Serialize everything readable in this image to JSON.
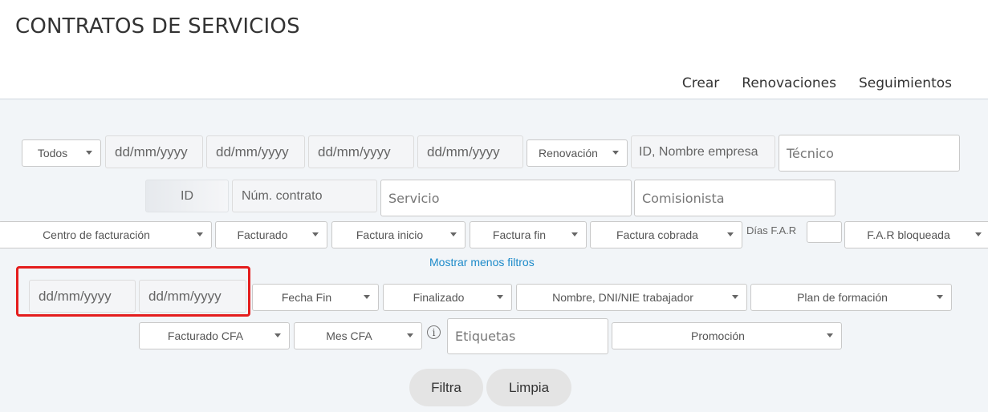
{
  "page": {
    "title": "CONTRATOS DE SERVICIOS"
  },
  "nav": {
    "crear": "Crear",
    "renovaciones": "Renovaciones",
    "seguimientos": "Seguimientos"
  },
  "filters": {
    "row1": {
      "todos": "Todos",
      "date1": "dd/mm/yyyy",
      "date2": "dd/mm/yyyy",
      "date3": "dd/mm/yyyy",
      "date4": "dd/mm/yyyy",
      "renovacion": "Renovación",
      "empresa_placeholder": "ID, Nombre empresa",
      "tecnico_placeholder": "Técnico"
    },
    "row2": {
      "id_placeholder": "ID",
      "contrato_placeholder": "Núm. contrato",
      "servicio_placeholder": "Servicio",
      "comisionista_placeholder": "Comisionista"
    },
    "row3": {
      "centro": "Centro de facturación",
      "facturado": "Facturado",
      "factura_inicio": "Factura inicio",
      "factura_fin": "Factura fin",
      "factura_cobrada": "Factura cobrada",
      "dias_far_label": "Días F.A.R",
      "far_bloqueada": "F.A.R bloqueada"
    },
    "toggle_link": "Mostrar menos filtros",
    "row4": {
      "date5": "dd/mm/yyyy",
      "date6": "dd/mm/yyyy",
      "fecha_fin": "Fecha Fin",
      "finalizado": "Finalizado",
      "trabajador": "Nombre, DNI/NIE trabajador",
      "plan": "Plan de formación"
    },
    "row5": {
      "facturado_cfa": "Facturado CFA",
      "mes_cfa": "Mes CFA",
      "info_icon": "i",
      "etiquetas_placeholder": "Etiquetas",
      "promocion": "Promoción"
    },
    "buttons": {
      "filtra": "Filtra",
      "limpia": "Limpia"
    }
  },
  "colors": {
    "highlight": "#e41d1d",
    "link": "#1d8ac9",
    "panel": "#f2f5f8"
  }
}
